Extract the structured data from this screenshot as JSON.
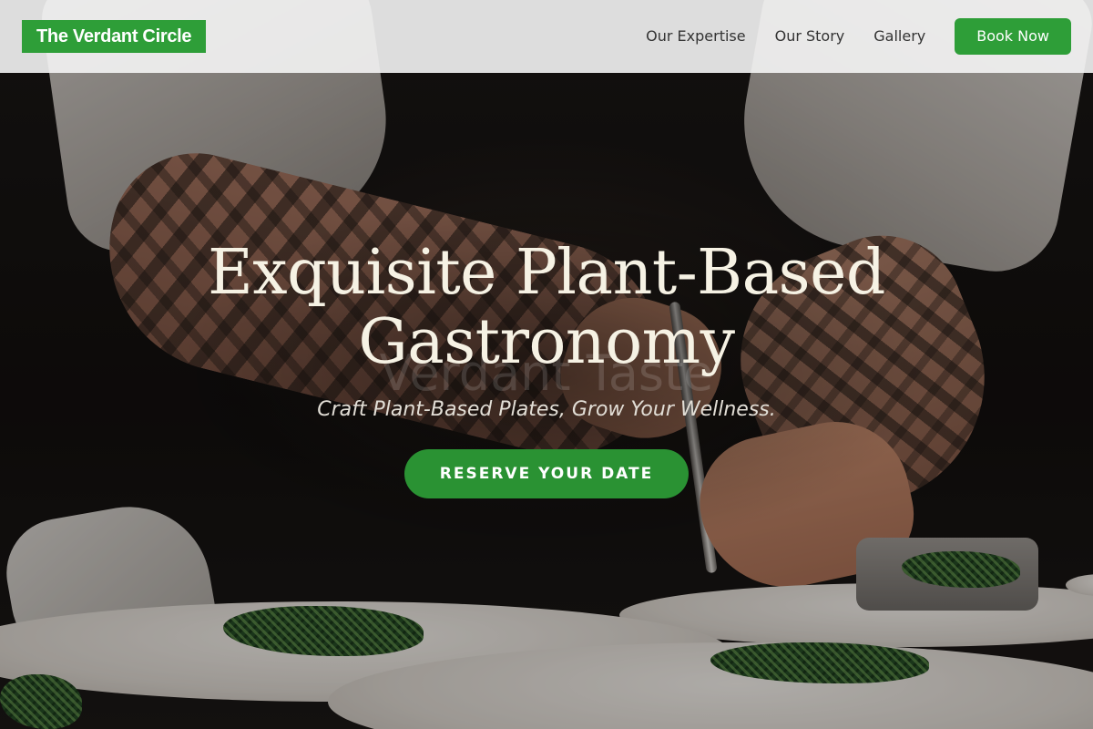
{
  "brand": {
    "name": "The Verdant Circle",
    "accent_color": "#2e9e38"
  },
  "nav": {
    "items": [
      {
        "label": "Our Expertise"
      },
      {
        "label": "Our Story"
      },
      {
        "label": "Gallery"
      }
    ],
    "cta_label": "Book Now"
  },
  "hero": {
    "title_line_1": "Exquisite Plant-Based",
    "title_line_2": "Gastronomy",
    "watermark": "Verdant Taste",
    "subtitle": "Craft Plant-Based Plates, Grow Your Wellness.",
    "cta_label": "RESERVE YOUR DATE",
    "background_image": "chef-plating-greens-photo"
  }
}
